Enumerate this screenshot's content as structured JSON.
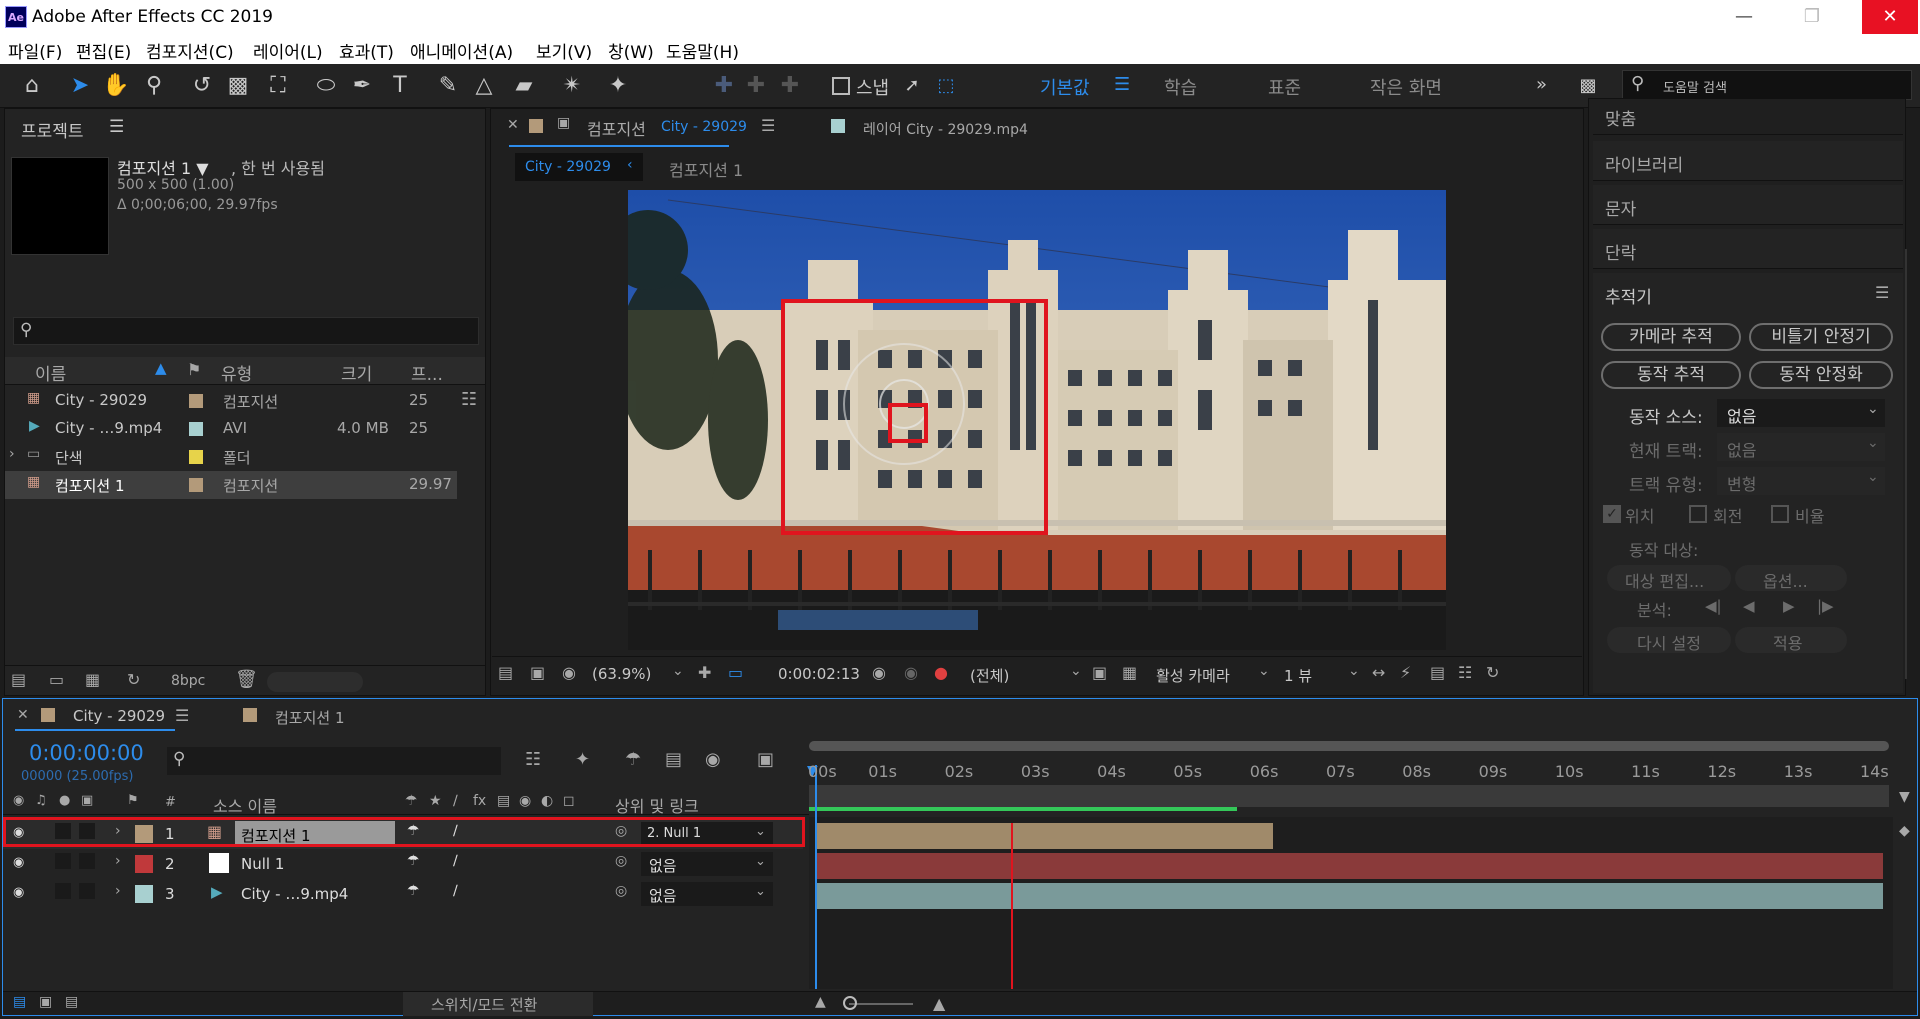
{
  "app": {
    "icon_label": "Ae",
    "title": "Adobe After Effects CC 2019"
  },
  "menu": [
    "파일(F)",
    "편집(E)",
    "컴포지션(C)",
    "레이어(L)",
    "효과(T)",
    "애니메이션(A)",
    "보기(V)",
    "창(W)",
    "도움말(H)"
  ],
  "toolbar": {
    "snap_label": "스냅",
    "workspaces": [
      "기본값",
      "학습",
      "표준",
      "작은 화면"
    ],
    "search_placeholder": "도움말 검색"
  },
  "project": {
    "tab": "프로젝트",
    "comp_name": "컴포지션 1 ▼",
    "comp_used": ", 한 번 사용됨",
    "comp_size": "500 x 500 (1.00)",
    "comp_duration": "Δ 0;00;06;00, 29.97fps",
    "columns": [
      "이름",
      "유형",
      "크기",
      "프..."
    ],
    "items": [
      {
        "name": "City - 29029",
        "type": "컴포지션",
        "size": "",
        "fps": "25",
        "color": "#b39a7a"
      },
      {
        "name": "City - …9.mp4",
        "type": "AVI",
        "size": "4.0 MB",
        "fps": "25",
        "color": "#a8d0d0"
      },
      {
        "name": "단색",
        "type": "폴더",
        "size": "",
        "fps": "",
        "color": "#e7d34a"
      },
      {
        "name": "컴포지션 1",
        "type": "컴포지션",
        "size": "",
        "fps": "29.97",
        "color": "#b39a7a"
      }
    ],
    "bpc": "8bpc"
  },
  "viewer": {
    "comp_tab": "컴포지션",
    "comp_tab_name": "City - 29029",
    "layer_tab": "레이어 City - 29029.mp4",
    "breadcrumb": [
      "City - 29029",
      "컴포지션 1"
    ],
    "zoom": "(63.9%)",
    "timecode": "0:00:02:13",
    "resolution": "(전체)",
    "camera": "활성 카메라",
    "views": "1 뷰"
  },
  "right_panel": {
    "sections": [
      "맞춤",
      "라이브러리",
      "문자",
      "단락"
    ],
    "tracker": {
      "title": "추적기",
      "buttons": [
        "카메라 추적",
        "비틀기 안정기",
        "동작 추적",
        "동작 안정화"
      ],
      "motion_source_label": "동작 소스:",
      "motion_source_value": "없음",
      "current_track_label": "현재 트랙:",
      "current_track_value": "없음",
      "track_type_label": "트랙 유형:",
      "track_type_value": "변형",
      "position": "위치",
      "rotation": "회전",
      "scale": "비율",
      "motion_target": "동작 대상:",
      "edit_target": "대상 편집...",
      "options": "옵션...",
      "analyze": "분석:",
      "reset": "다시 설정",
      "apply": "적용"
    }
  },
  "timeline": {
    "tab_active": "City - 29029",
    "tab_other": "컴포지션 1",
    "timecode": "0:00:00:00",
    "frame_info": "00000 (25.00fps)",
    "col_source": "소스 이름",
    "col_parent": "상위 및 링크",
    "col_num": "#",
    "layers": [
      {
        "num": "1",
        "name": "컴포지션 1",
        "parent": "2. Null 1",
        "color": "#b39a7a"
      },
      {
        "num": "2",
        "name": "Null 1",
        "parent": "없음",
        "color": "#c0393b"
      },
      {
        "num": "3",
        "name": "City - …9.mp4",
        "parent": "없음",
        "color": "#a8d0d0"
      }
    ],
    "ruler": [
      "00s",
      "01s",
      "02s",
      "03s",
      "04s",
      "05s",
      "06s",
      "07s",
      "08s",
      "09s",
      "10s",
      "11s",
      "12s",
      "13s",
      "14s"
    ],
    "footer": "스위치/모드 전환"
  }
}
